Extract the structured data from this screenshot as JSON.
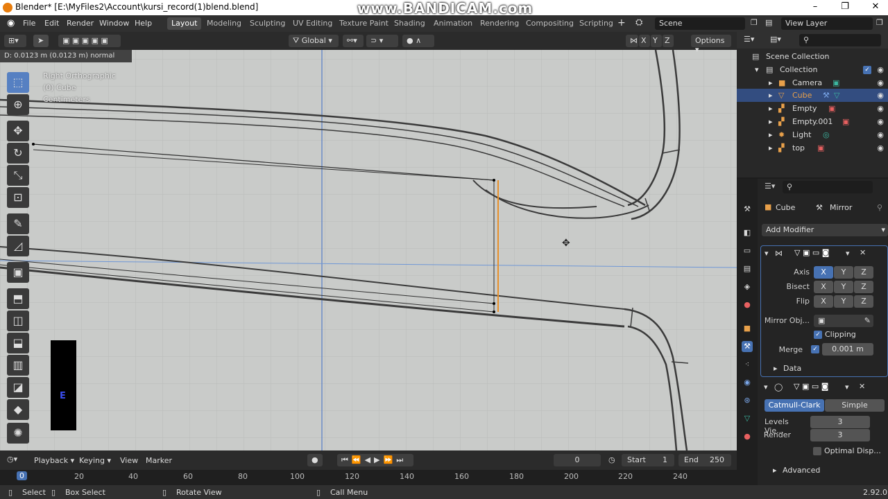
{
  "window": {
    "title": "Blender* [E:\\MyFiles2\\Account\\kursi_record(1)blend.blend]",
    "watermark": "www.BANDICAM.com",
    "controls": [
      "–",
      "❐",
      "✕"
    ]
  },
  "menu": {
    "items": [
      "File",
      "Edit",
      "Render",
      "Window",
      "Help"
    ],
    "workspaces": [
      "Layout",
      "Modeling",
      "Sculpting",
      "UV Editing",
      "Texture Paint",
      "Shading",
      "Animation",
      "Rendering",
      "Compositing",
      "Scripting"
    ],
    "active_workspace": "Layout",
    "scene": "Scene",
    "view_layer": "View Layer"
  },
  "viewport_header": {
    "orientation": "Global",
    "options": "Options",
    "axes": [
      "X",
      "Y",
      "Z"
    ]
  },
  "viewport": {
    "operator_note": "D: 0.0123 m (0.0123 m) normal",
    "view_name": "Right Orthographic",
    "object_label": "(0) Cube",
    "units": "Centimeters",
    "key_overlay": "E"
  },
  "outliner": {
    "root": "Scene Collection",
    "collection": "Collection",
    "items": [
      {
        "name": "Camera",
        "icon": "camera-icon",
        "color": "#e8a04a",
        "selected": false
      },
      {
        "name": "Cube",
        "icon": "mesh-icon",
        "color": "#e8a04a",
        "selected": true
      },
      {
        "name": "Empty",
        "icon": "empty-icon",
        "color": "#e8a04a",
        "selected": false
      },
      {
        "name": "Empty.001",
        "icon": "empty-icon",
        "color": "#e8a04a",
        "selected": false
      },
      {
        "name": "Light",
        "icon": "light-icon",
        "color": "#e8a04a",
        "selected": false
      },
      {
        "name": "top",
        "icon": "empty-icon",
        "color": "#e8a04a",
        "selected": false
      }
    ]
  },
  "properties": {
    "object_name": "Cube",
    "modifier_name": "Mirror",
    "add_modifier": "Add Modifier",
    "mirror": {
      "axis_label": "Axis",
      "bisect_label": "Bisect",
      "flip_label": "Flip",
      "axes": [
        "X",
        "Y",
        "Z"
      ],
      "mirror_object_label": "Mirror Obj...",
      "clipping_label": "Clipping",
      "merge_label": "Merge",
      "merge_value": "0.001 m",
      "data_label": "Data"
    },
    "subsurf": {
      "catmull": "Catmull-Clark",
      "simple": "Simple",
      "levels_label": "Levels Vie...",
      "levels_value": "3",
      "render_label": "Render",
      "render_value": "3",
      "optimal_label": "Optimal Disp...",
      "advanced_label": "Advanced"
    }
  },
  "timeline": {
    "menus": [
      "Playback",
      "Keying",
      "View",
      "Marker"
    ],
    "current_frame": "0",
    "start_label": "Start",
    "start_value": "1",
    "end_label": "End",
    "end_value": "250",
    "ticks": [
      "0",
      "20",
      "40",
      "60",
      "80",
      "100",
      "120",
      "140",
      "160",
      "180",
      "200",
      "220",
      "240"
    ]
  },
  "statusbar": {
    "select": "Select",
    "box_select": "Box Select",
    "rotate_view": "Rotate View",
    "call_menu": "Call Menu",
    "version": "2.92.0"
  },
  "colors": {
    "accent": "#4772b3",
    "selection": "#334d80",
    "viewport_bg": "#c9cbc9",
    "selected_edge": "#e8902a"
  }
}
